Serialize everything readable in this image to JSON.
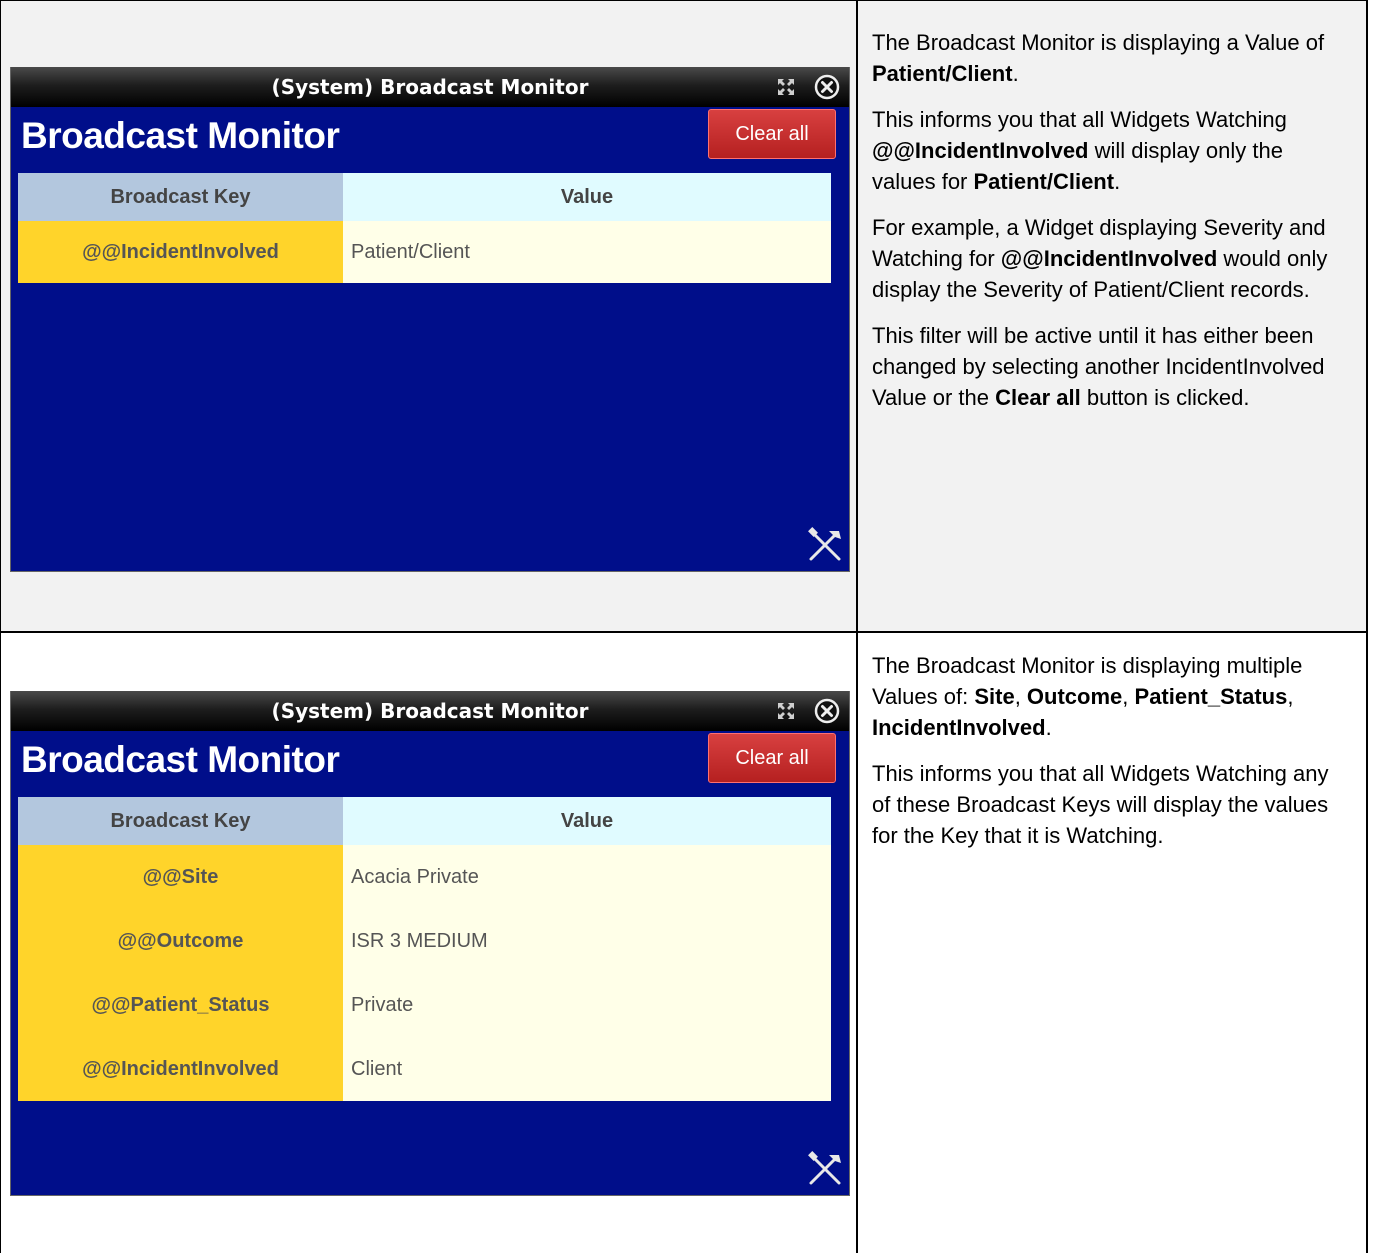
{
  "panel_top": {
    "window_title": "(System) Broadcast Monitor",
    "heading": "Broadcast Monitor",
    "clear_label": "Clear all",
    "columns": {
      "key": "Broadcast Key",
      "value": "Value"
    },
    "rows": [
      {
        "key": "@@IncidentInvolved",
        "value": "Patient/Client"
      }
    ]
  },
  "panel_bottom": {
    "window_title": "(System) Broadcast Monitor",
    "heading": "Broadcast Monitor",
    "clear_label": "Clear all",
    "columns": {
      "key": "Broadcast Key",
      "value": "Value"
    },
    "rows": [
      {
        "key": "@@Site",
        "value": "Acacia Private"
      },
      {
        "key": "@@Outcome",
        "value": "ISR 3 MEDIUM"
      },
      {
        "key": "@@Patient_Status",
        "value": "Private"
      },
      {
        "key": "@@IncidentInvolved",
        "value": "Client"
      }
    ]
  },
  "desc_top": {
    "p1": {
      "a": "The Broadcast Monitor is displaying a Value of ",
      "b": "Patient/Client",
      "c": "."
    },
    "p2": {
      "a": "This informs you that all Widgets Watching ",
      "b": "@@IncidentInvolved",
      "c": " will display only the values for ",
      "d": "Patient/Client",
      "e": "."
    },
    "p3": {
      "a": "For example, a Widget displaying Severity and Watching for ",
      "b": "@@IncidentInvolved",
      "c": " would only display the Severity of Patient/Client records."
    },
    "p4": {
      "a": "This filter will be active until it has either been changed by selecting another IncidentInvolved Value or the ",
      "b": "Clear all",
      "c": " button is clicked."
    }
  },
  "desc_bottom": {
    "p1": {
      "a": "The Broadcast Monitor is displaying multiple Values of: ",
      "b": "Site",
      "c": ", ",
      "d": "Outcome",
      "e": ", ",
      "f": "Patient_Status",
      "g": ", ",
      "h": "IncidentInvolved",
      "i": "."
    },
    "p2": {
      "a": "This informs you that all Widgets Watching any of these Broadcast Keys will display the values for the Key that it is Watching."
    }
  },
  "colors": {
    "widget_bg": "#000e8a",
    "key_cell": "#ffd42a",
    "value_cell": "#ffffe8",
    "header_key": "#b3c7de",
    "header_value": "#e0fbff",
    "clear_button": "#c62b2b",
    "top_row_bg": "#f2f2f2"
  },
  "icons": [
    "expand-icon",
    "close-icon",
    "tools-icon"
  ]
}
